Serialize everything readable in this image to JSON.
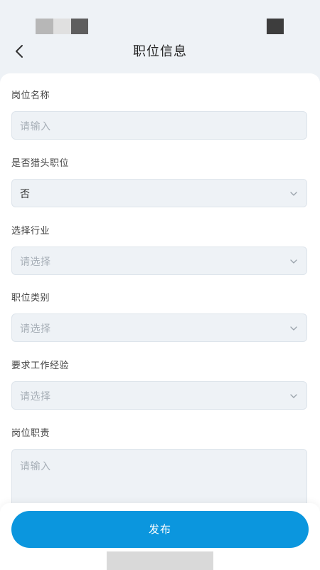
{
  "header": {
    "title": "职位信息"
  },
  "form": {
    "fields": [
      {
        "label": "岗位名称",
        "placeholder": "请输入",
        "value": ""
      },
      {
        "label": "是否猎头职位",
        "placeholder": "",
        "value": "否"
      },
      {
        "label": "选择行业",
        "placeholder": "请选择",
        "value": ""
      },
      {
        "label": "职位类别",
        "placeholder": "请选择",
        "value": ""
      },
      {
        "label": "要求工作经验",
        "placeholder": "请选择",
        "value": ""
      },
      {
        "label": "岗位职责",
        "placeholder": "请输入",
        "value": ""
      }
    ]
  },
  "footer": {
    "publish_label": "发布"
  },
  "colors": {
    "accent": "#0b96de",
    "input_bg": "#eef2f6",
    "placeholder": "#a8b0b8"
  },
  "icons": {
    "back": "chevron-left-icon",
    "dropdown": "chevron-down-icon"
  }
}
